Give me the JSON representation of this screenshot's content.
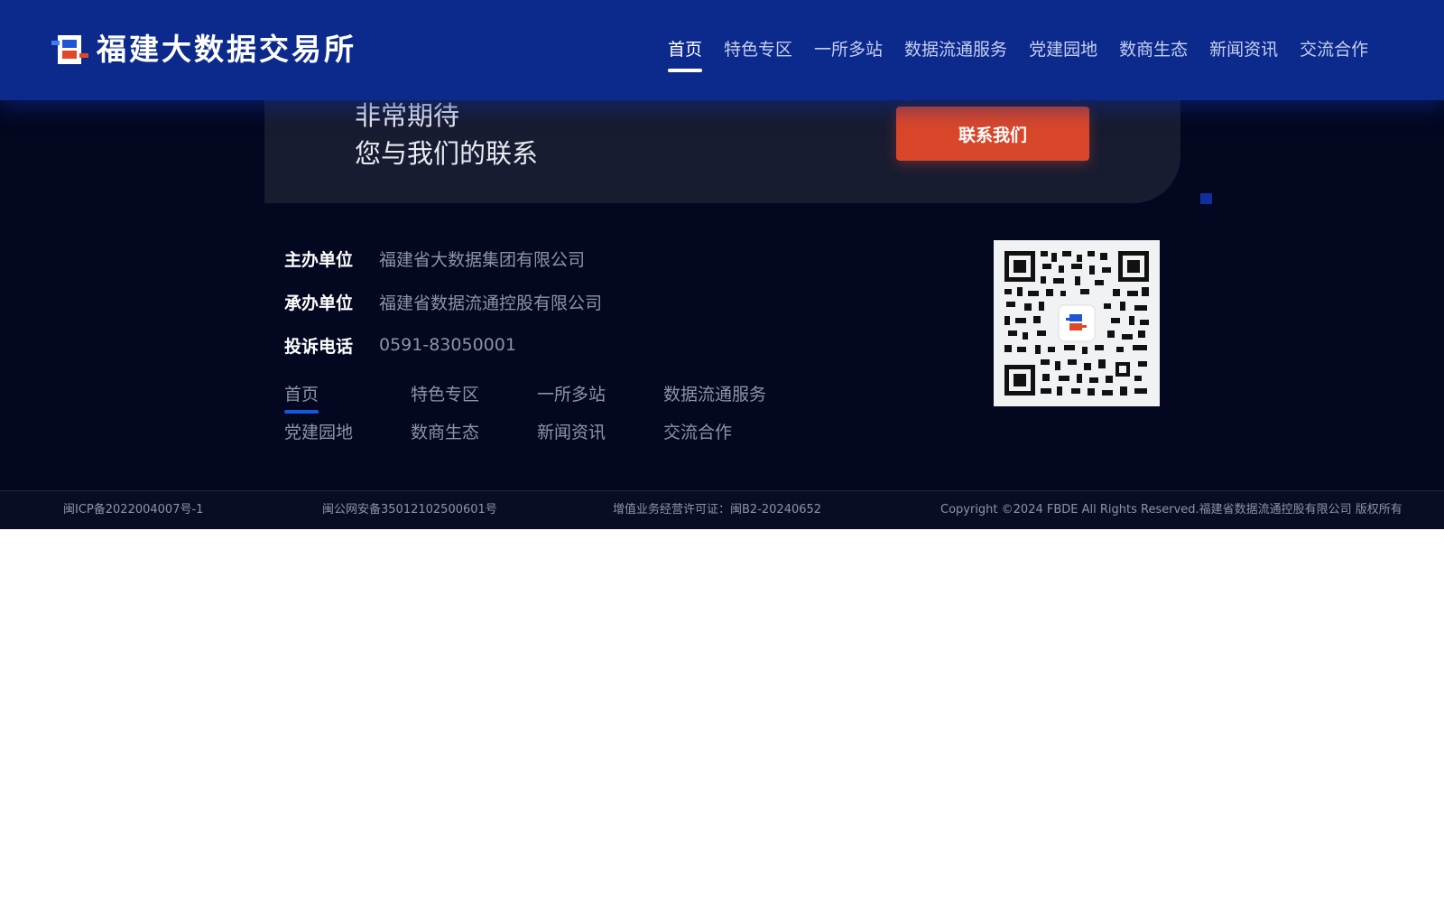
{
  "header": {
    "logo_text": "福建大数据交易所",
    "nav": [
      {
        "label": "首页",
        "active": true
      },
      {
        "label": "特色专区"
      },
      {
        "label": "一所多站"
      },
      {
        "label": "数据流通服务"
      },
      {
        "label": "党建园地"
      },
      {
        "label": "数商生态"
      },
      {
        "label": "新闻资讯"
      },
      {
        "label": "交流合作"
      }
    ]
  },
  "contact": {
    "line1": "非常期待",
    "line2": "您与我们的联系",
    "button_label": "联系我们"
  },
  "info": {
    "host_label": "主办单位",
    "host_value": "福建省大数据集团有限公司",
    "organizer_label": "承办单位",
    "organizer_value": "福建省数据流通控股有限公司",
    "complaint_label": "投诉电话",
    "complaint_value": "0591-83050001"
  },
  "footer_links": [
    "首页",
    "特色专区",
    "一所多站",
    "数据流通服务",
    "党建园地",
    "数商生态",
    "新闻资讯",
    "交流合作"
  ],
  "legal": {
    "icp": "闽ICP备2022004007号-1",
    "police": "闽公网安备35012102500601号",
    "license": "增值业务经营许可证：闽B2-20240652",
    "copyright": "Copyright ©2024 FBDE All Rights Reserved.福建省数据流通控股有限公司 版权所有"
  },
  "colors": {
    "header_bg": "#0c2a8c",
    "footer_bg": "#030720",
    "card_bg": "#181c31",
    "button_bg": "#d9472b",
    "accent_underline": "#1557e0"
  },
  "icons": {
    "logo": "fbde-logo-icon",
    "qr": "wechat-qr-code-icon"
  }
}
